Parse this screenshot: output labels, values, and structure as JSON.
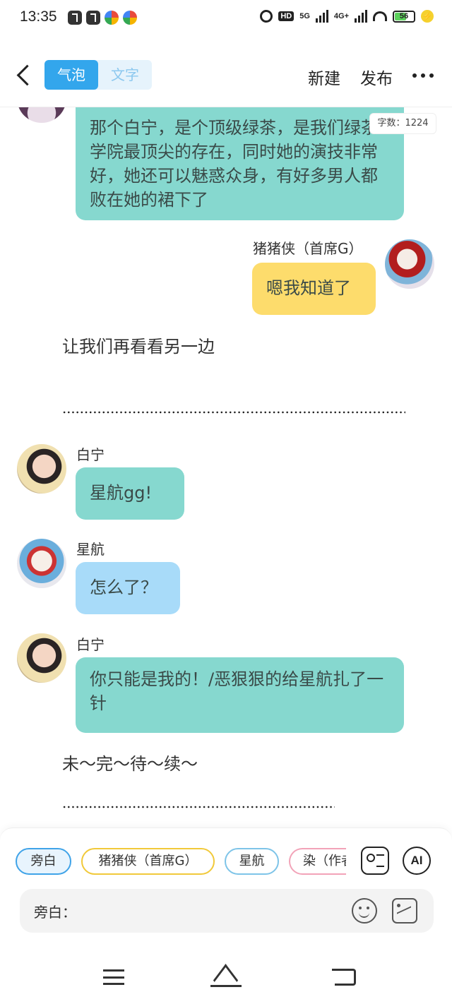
{
  "status_bar": {
    "time": "13:35",
    "hd": "HD",
    "net1": "5G",
    "net2": "4G+",
    "battery": "56"
  },
  "header": {
    "mode_bubble": "气泡",
    "mode_text": "文字",
    "new_label": "新建",
    "publish_label": "发布"
  },
  "word_count": "字数：1224",
  "messages": [
    {
      "speaker": "",
      "text": "那个白宁，是个顶级绿茶，是我们绿茶学院最顶尖的存在，同时她的演技非常好，她还可以魅惑众身，有好多男人都败在她的裙下了",
      "color": "#86d8cf"
    },
    {
      "speaker": "猪猪侠（首席G）",
      "text": "嗯我知道了",
      "color": "#fddc6c"
    },
    {
      "speaker": "",
      "text": "让我们再看看另一边"
    },
    {
      "speaker": "白宁",
      "text": "星航gg!",
      "color": "#86d8cf"
    },
    {
      "speaker": "星航",
      "text": "怎么了？",
      "color": "#a8dbf9"
    },
    {
      "speaker": "白宁",
      "text": "你只能是我的！/恶狠狠的给星航扎了一针",
      "color": "#86d8cf"
    },
    {
      "speaker": "",
      "text": "未～完～待～续～"
    }
  ],
  "roles": {
    "narrator": "旁白",
    "pig": "猪猪侠（首席G）",
    "xinghang": "星航",
    "ran": "染（作者）"
  },
  "ai_label": "AI",
  "input": {
    "label": "旁白："
  }
}
